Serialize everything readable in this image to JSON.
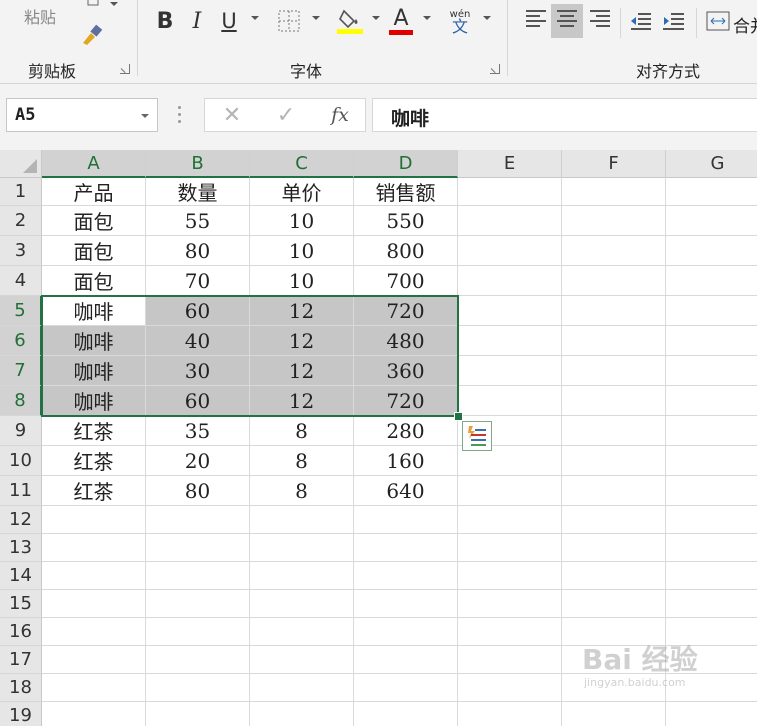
{
  "ribbon": {
    "clipboard": {
      "paste_label": "粘贴",
      "group_label": "剪贴板"
    },
    "font": {
      "group_label": "字体",
      "bold": "B",
      "italic": "I",
      "underline": "U",
      "font_color_letter": "A",
      "phonetic_top": "wén",
      "phonetic_bottom": "文",
      "fill_color": "#ffff00",
      "font_color": "#e00000"
    },
    "alignment": {
      "group_label": "对齐方式",
      "merge_label": "合并"
    }
  },
  "formula_bar": {
    "name_box": "A5",
    "cancel": "✕",
    "enter": "✓",
    "fx": "fx",
    "content": "咖啡"
  },
  "sheet": {
    "columns": [
      "A",
      "B",
      "C",
      "D",
      "E",
      "F",
      "G"
    ],
    "rows": [
      "1",
      "2",
      "3",
      "4",
      "5",
      "6",
      "7",
      "8",
      "9",
      "10",
      "11",
      "12",
      "13",
      "14",
      "15",
      "16",
      "17",
      "18",
      "19"
    ],
    "cells": [
      [
        "产品",
        "数量",
        "单价",
        "销售额"
      ],
      [
        "面包",
        "55",
        "10",
        "550"
      ],
      [
        "面包",
        "80",
        "10",
        "800"
      ],
      [
        "面包",
        "70",
        "10",
        "700"
      ],
      [
        "咖啡",
        "60",
        "12",
        "720"
      ],
      [
        "咖啡",
        "40",
        "12",
        "480"
      ],
      [
        "咖啡",
        "30",
        "12",
        "360"
      ],
      [
        "咖啡",
        "60",
        "12",
        "720"
      ],
      [
        "红茶",
        "35",
        "8",
        "280"
      ],
      [
        "红茶",
        "20",
        "8",
        "160"
      ],
      [
        "红茶",
        "80",
        "8",
        "640"
      ]
    ],
    "selection": "A5:D8",
    "accent": "#217346"
  },
  "watermark": {
    "text": "Bai 经验",
    "sub": "jingyan.baidu.com"
  }
}
